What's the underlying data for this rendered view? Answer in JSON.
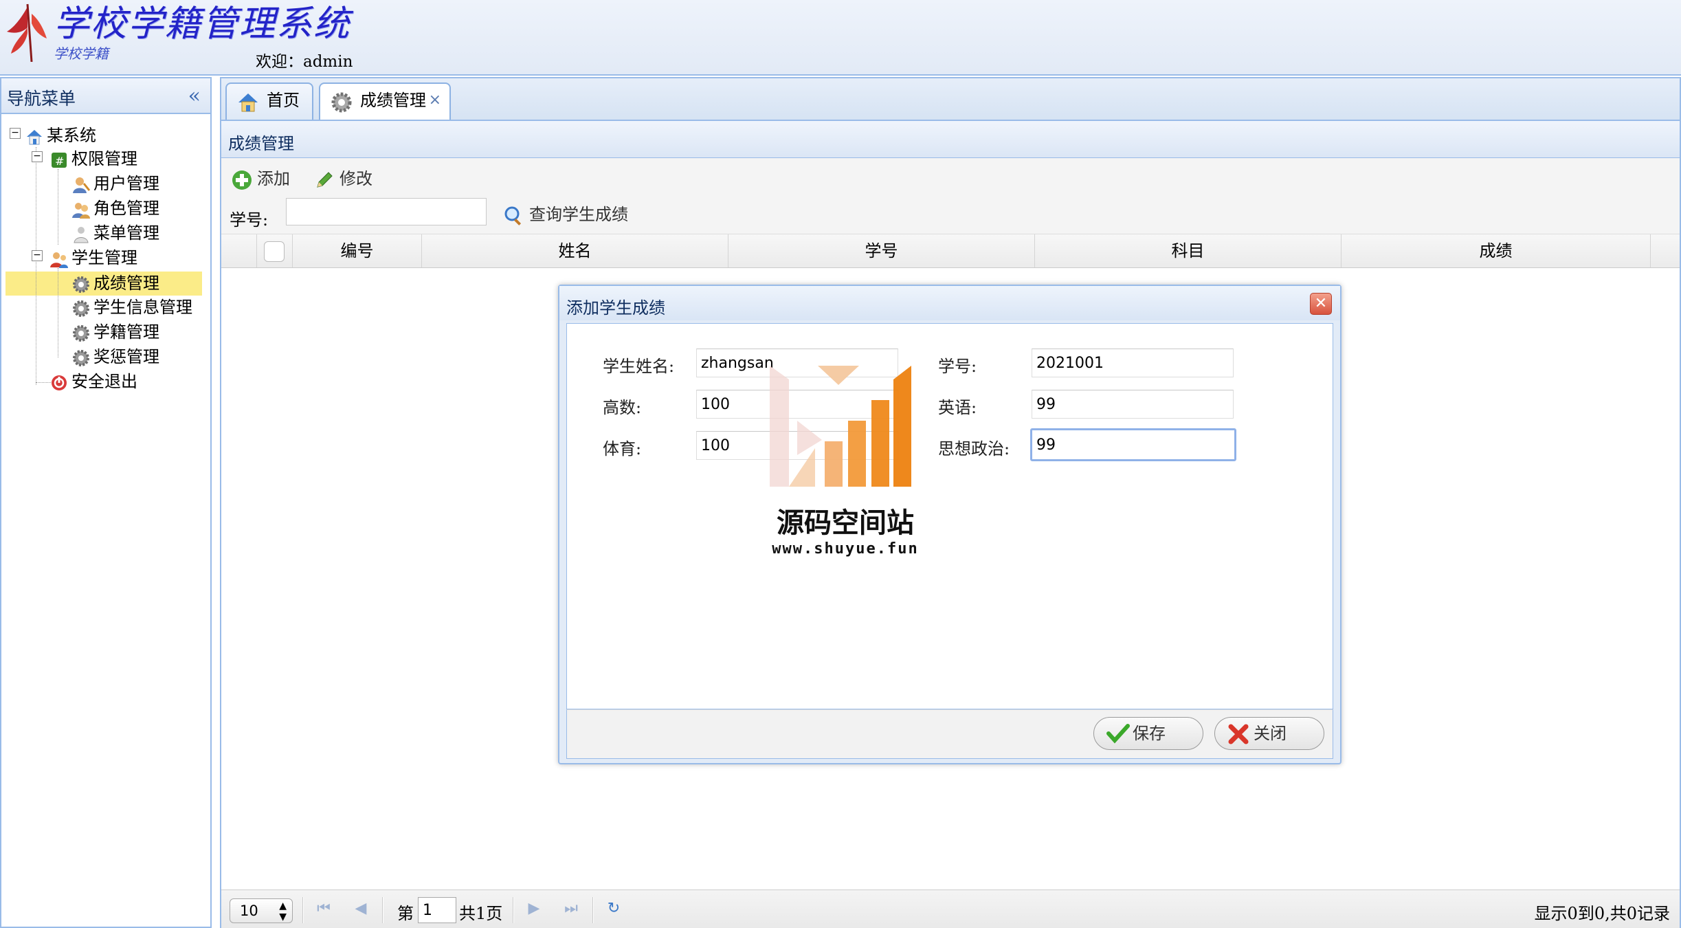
{
  "header": {
    "app_title": "学校学籍管理系统",
    "app_subtitle": "学校学籍",
    "welcome": "欢迎：admin"
  },
  "sidebar": {
    "title": "导航菜单",
    "collapse_glyph": "«",
    "tree": {
      "root": "某系统",
      "perm_group": "权限管理",
      "user_mgmt": "用户管理",
      "role_mgmt": "角色管理",
      "menu_mgmt": "菜单管理",
      "student_group": "学生管理",
      "score_mgmt": "成绩管理",
      "student_info": "学生信息管理",
      "enroll_mgmt": "学籍管理",
      "reward_mgmt": "奖惩管理",
      "logout": "安全退出"
    },
    "selected": "成绩管理"
  },
  "tabs": [
    {
      "label": "首页",
      "active": false
    },
    {
      "label": "成绩管理",
      "active": true,
      "close_glyph": "×"
    }
  ],
  "panel": {
    "title": "成绩管理",
    "toolbar": {
      "add": "添加",
      "edit": "修改"
    },
    "search": {
      "label": "学号:",
      "value": "",
      "button": "查询学生成绩"
    },
    "columns": [
      "编号",
      "姓名",
      "学号",
      "科目",
      "成绩"
    ]
  },
  "pager": {
    "page_size": "10",
    "page_prefix": "第",
    "page": "1",
    "page_total": "共1页",
    "info": "显示0到0,共0记录"
  },
  "dialog": {
    "title": "添加学生成绩",
    "close_glyph": "✕",
    "fields": {
      "name_label": "学生姓名:",
      "name_value": "zhangsan",
      "id_label": "学号:",
      "id_value": "2021001",
      "math_label": "高数:",
      "math_value": "100",
      "english_label": "英语:",
      "english_value": "99",
      "pe_label": "体育:",
      "pe_value": "100",
      "politics_label": "思想政治:",
      "politics_value": "99"
    },
    "save": "保存",
    "close": "关闭"
  },
  "watermark": {
    "text": "源码空间站",
    "url": "www.shuyue.fun"
  },
  "colors": {
    "border": "#99bbe8",
    "selected_row": "#fbec88",
    "title_blue": "#2323c8",
    "watermark_orange": "#f08a1c"
  }
}
